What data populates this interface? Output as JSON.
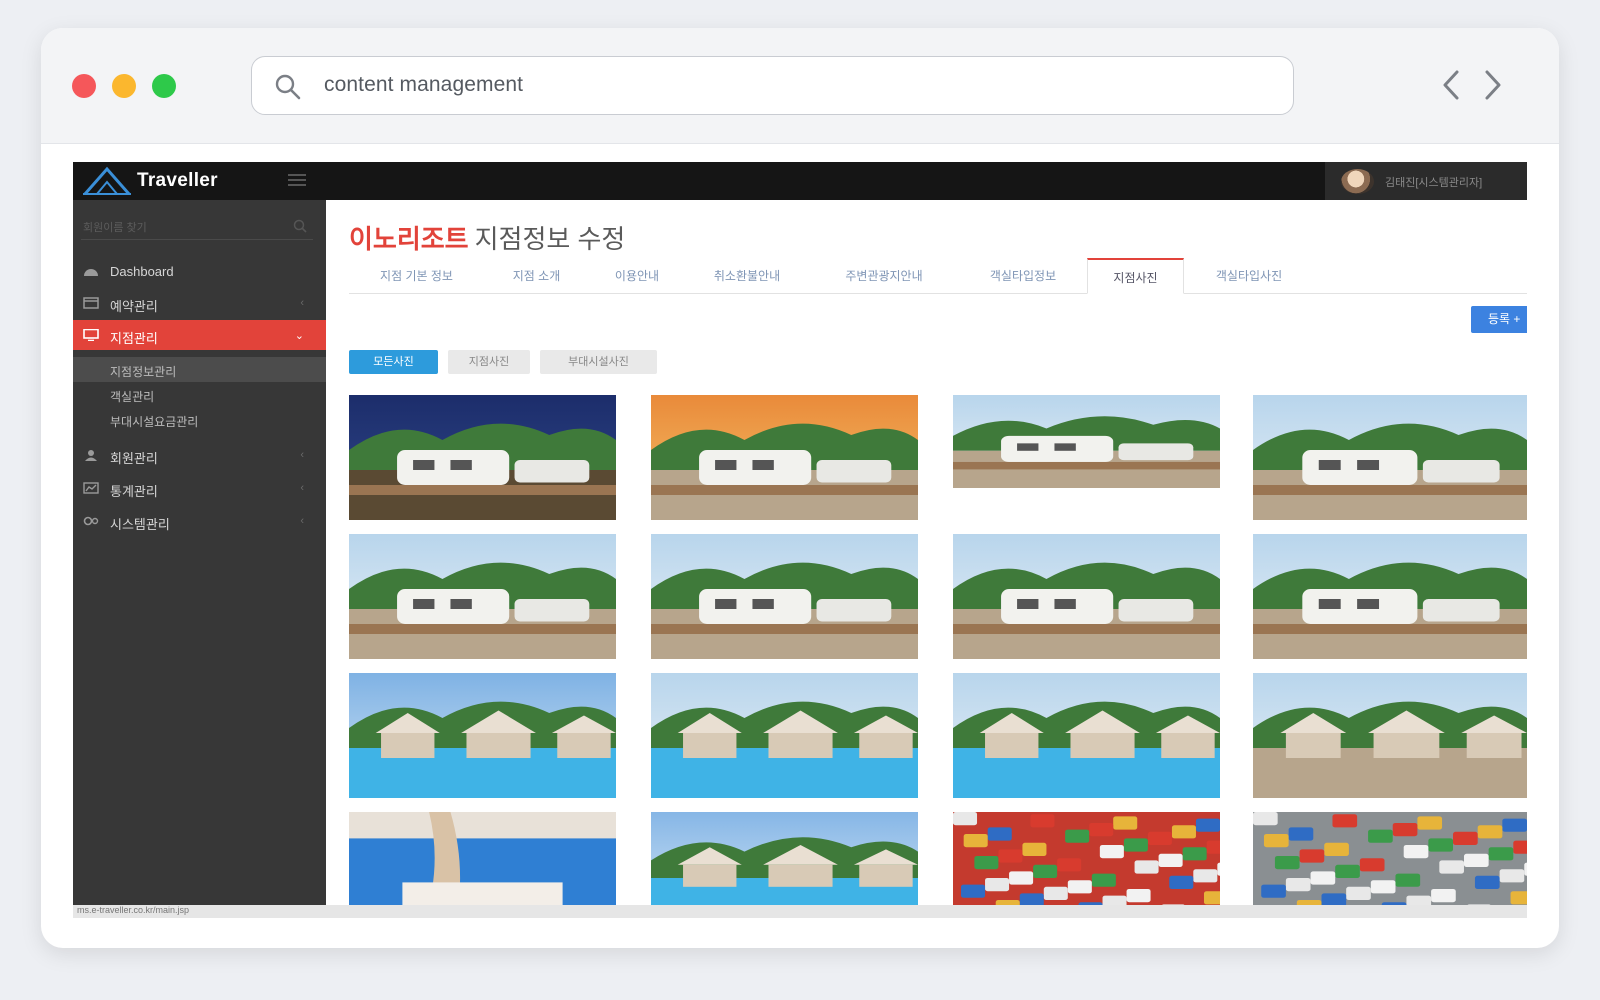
{
  "browser": {
    "address_text": "content management",
    "icons": {
      "search": "search-icon",
      "back": "chevron-left-icon",
      "forward": "chevron-right-icon"
    }
  },
  "app": {
    "brand": "Traveller",
    "user_name": "김태진[시스템관리자]",
    "status_url": "ms.e-traveller.co.kr/main.jsp",
    "colors": {
      "accent": "#e2433a",
      "primary_button": "#3c82e0",
      "filter_active": "#2d9bdc",
      "sidebar": "#373737",
      "topbar": "#151515"
    }
  },
  "sidebar": {
    "search_placeholder": "회원이름 찾기",
    "items": [
      {
        "label": "Dashboard",
        "icon": "dashboard-icon"
      },
      {
        "label": "예약관리",
        "icon": "calendar-icon"
      },
      {
        "label": "지점관리",
        "icon": "monitor-icon",
        "active": true
      },
      {
        "label": "회원관리",
        "icon": "users-icon"
      },
      {
        "label": "통계관리",
        "icon": "chart-icon"
      },
      {
        "label": "시스템관리",
        "icon": "settings-icon"
      }
    ],
    "sub_items": [
      {
        "label": "지점정보관리"
      },
      {
        "label": "객실관리"
      },
      {
        "label": "부대시설요금관리"
      }
    ]
  },
  "main": {
    "title_highlight": "이노리조트",
    "title_rest": "지점정보 수정",
    "tabs": [
      {
        "label": "지점 기본 정보"
      },
      {
        "label": "지점 소개"
      },
      {
        "label": "이용안내"
      },
      {
        "label": "취소환불안내"
      },
      {
        "label": "주변관광지안내"
      },
      {
        "label": "객실타입정보"
      },
      {
        "label": "지점사진",
        "active": true
      },
      {
        "label": "객실타입사진"
      }
    ],
    "register_button": "등록 +",
    "filters": [
      {
        "label": "모든사진",
        "active": true
      },
      {
        "label": "지점사진"
      },
      {
        "label": "부대시설사진"
      }
    ],
    "photos": [
      {
        "subject": "camper-night"
      },
      {
        "subject": "camper-sunset"
      },
      {
        "subject": "camper-row-trees"
      },
      {
        "subject": "camper-deck-sunny"
      },
      {
        "subject": "campers-riverside"
      },
      {
        "subject": "camper-closeup-deck"
      },
      {
        "subject": "camper-awning-tables"
      },
      {
        "subject": "camper-row-forest"
      },
      {
        "subject": "pool-gazebos-mountain"
      },
      {
        "subject": "pool-gazebos"
      },
      {
        "subject": "pool-gazebos-wide"
      },
      {
        "subject": "gazebo-single"
      },
      {
        "subject": "gazebo-interior"
      },
      {
        "subject": "pool-gazebos-mountain-2"
      },
      {
        "subject": "snack-shelves"
      },
      {
        "subject": "convenience-store"
      }
    ]
  }
}
